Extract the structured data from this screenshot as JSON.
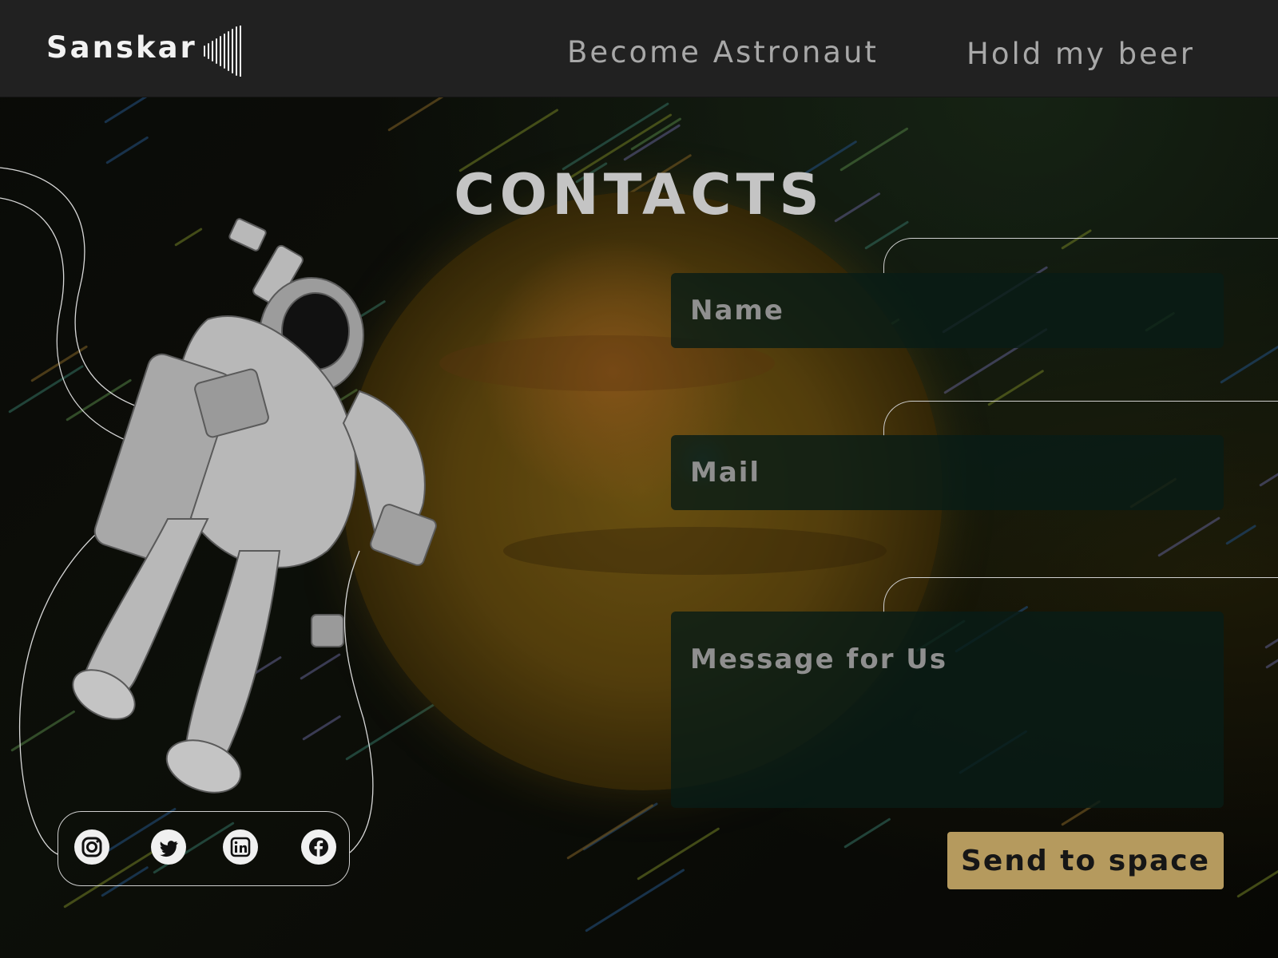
{
  "header": {
    "brand": "Sanskar",
    "brand_icon": "sound-wave-icon",
    "nav": [
      {
        "label": "Become Astronaut"
      },
      {
        "label": "Hold my beer"
      }
    ]
  },
  "main": {
    "title": "CONTACTS",
    "form": {
      "name_placeholder": "Name",
      "mail_placeholder": "Mail",
      "message_placeholder": "Message for Us",
      "submit_label": "Send to space"
    }
  },
  "socials": [
    {
      "icon": "instagram-icon"
    },
    {
      "icon": "twitter-icon"
    },
    {
      "icon": "linkedin-icon"
    },
    {
      "icon": "facebook-icon"
    }
  ],
  "colors": {
    "accent": "#b59a5e",
    "header_bg": "#212121",
    "field_bg": "#081c16",
    "nav_text": "#a8a8a8"
  }
}
